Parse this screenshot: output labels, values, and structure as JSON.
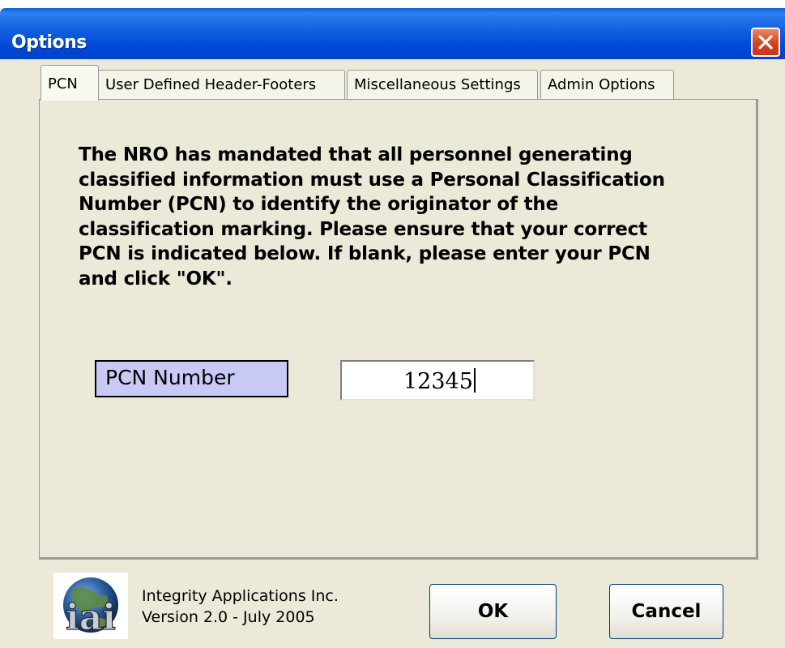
{
  "window": {
    "title": "Options"
  },
  "tabs": [
    {
      "label": "PCN",
      "active": true
    },
    {
      "label": "User Defined Header-Footers",
      "active": false
    },
    {
      "label": "Miscellaneous Settings",
      "active": false
    },
    {
      "label": "Admin Options",
      "active": false
    }
  ],
  "pcn": {
    "description": "The NRO has mandated that all personnel generating classified information must use a Personal Classification Number (PCN) to identify the originator of the classification marking.  Please ensure that your correct PCN is indicated below.  If blank, please enter your PCN and click \"OK\".",
    "label": "PCN Number",
    "value": "12345"
  },
  "footer": {
    "logo_text": "iai",
    "company": "Integrity Applications Inc.",
    "version": "Version 2.0 - July 2005",
    "ok_label": "OK",
    "cancel_label": "Cancel"
  },
  "colors": {
    "titlebar": "#0A5FDB",
    "dialog_bg": "#ECE9D8",
    "label_bg": "#C9C9F6",
    "close_red": "#D6421F"
  }
}
